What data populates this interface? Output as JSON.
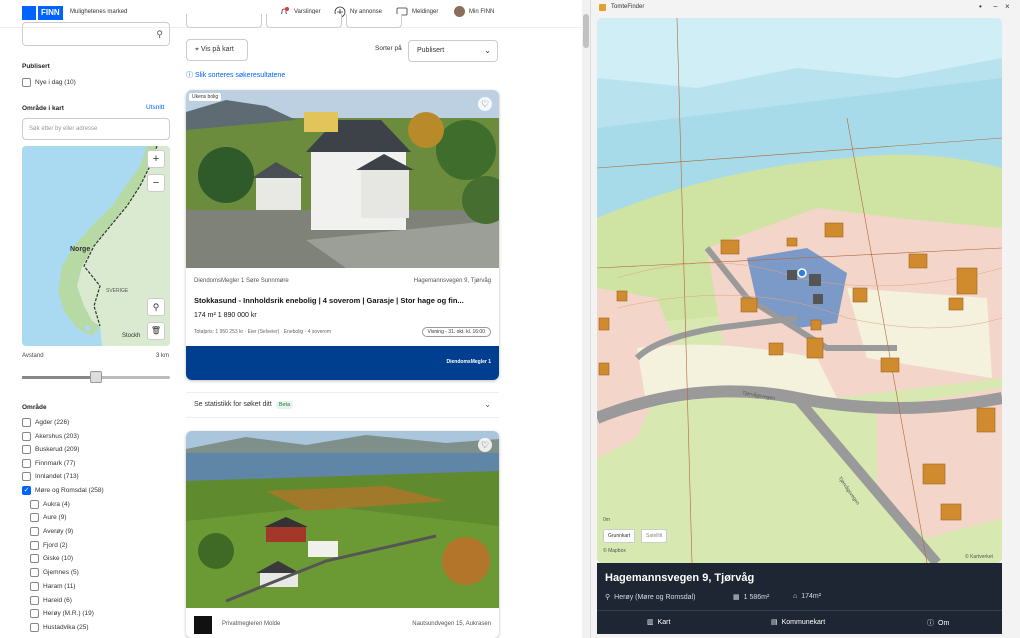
{
  "header": {
    "logo": "FINN",
    "tagline": "Mulighetenes marked",
    "nav": [
      {
        "label": "Varslinger",
        "icon": "bell-icon"
      },
      {
        "label": "Ny annonse",
        "icon": "plus-circle-icon"
      },
      {
        "label": "Meldinger",
        "icon": "chat-icon"
      },
      {
        "label": "Min FINN",
        "icon": "avatar-icon"
      }
    ]
  },
  "filters": {
    "published_heading": "Publisert",
    "published_new_today": "Nye i dag (10)",
    "map_area_heading": "Område i kart",
    "map_area_link": "Utsnitt",
    "address_placeholder": "Søk etter by eller adresse",
    "minimap_country": "Norge",
    "minimap_sweden": "SVERIGE",
    "minimap_stockholm": "Stockh",
    "distance_label": "Avstand",
    "distance_value": "3 km",
    "area_heading": "Område",
    "areas": [
      {
        "label": "Agder (226)",
        "checked": false
      },
      {
        "label": "Akershus (203)",
        "checked": false
      },
      {
        "label": "Buskerud (209)",
        "checked": false
      },
      {
        "label": "Finnmark (77)",
        "checked": false
      },
      {
        "label": "Innlandet (713)",
        "checked": false
      },
      {
        "label": "Møre og Romsdal (258)",
        "checked": true
      }
    ],
    "subareas": [
      "Aukra (4)",
      "Aure (9)",
      "Averøy (9)",
      "Fjord (2)",
      "Giske (10)",
      "Gjemnes (5)",
      "Haram (11)",
      "Hareid (6)",
      "Herøy (M.R.) (19)",
      "Hustadvika (25)"
    ]
  },
  "list": {
    "view_on_map": "Vis på kart",
    "sort_label": "Sorter på",
    "sort_value": "Publisert",
    "sort_info_link": "Slik sorteres søkeresultatene",
    "cards": [
      {
        "badge": "Ukens bolig",
        "agent": "DiendomsMegler 1 Søre Sunnmøre",
        "location": "Hagemannsvegen 9, Tjørvåg",
        "title": "Stokkasund - Innholdsrik enebolig | 4 soverom | Garasje | Stor hage og fin...",
        "price": "174 m²   1 890 000 kr",
        "meta": "Totalpris: 1 950 253 kr · Eier (Selveier) · Enebolig · 4 soverom",
        "viewing": "Visning - 31. okt. kl. 16:00",
        "banner_logo": "DiendomsMegler 1"
      },
      {
        "agent": "Privatmegleren Molde",
        "location": "Nautsundvegen 15, Aukrasen"
      }
    ],
    "stats_text": "Se statistikk for søket ditt",
    "stats_badge": "Beta"
  },
  "app": {
    "title": "TomteFinder",
    "map_toggle": [
      "Grunnkart",
      "Satellitt"
    ],
    "map_scale": "0m",
    "map_attrib_left": "© Mapbox",
    "map_attrib_right": "© Kartverket",
    "road_label": "Tjørvågsvegen",
    "road_label2": "Tjørvågsvegen",
    "address": "Hagemannsvegen 9, Tjørvåg",
    "municipality": "Herøy (Møre og Romsdal)",
    "plot_area": "1 586m²",
    "building_area": "174m²",
    "tabs": [
      {
        "label": "Kart",
        "icon": "map-icon"
      },
      {
        "label": "Kommunekart",
        "icon": "layers-icon"
      },
      {
        "label": "Om",
        "icon": "info-icon"
      }
    ],
    "colors": {
      "panel": "#1e2633",
      "plot": "#6f93c7",
      "building": "#d08b2f",
      "marker": "#2d7fe0"
    }
  }
}
